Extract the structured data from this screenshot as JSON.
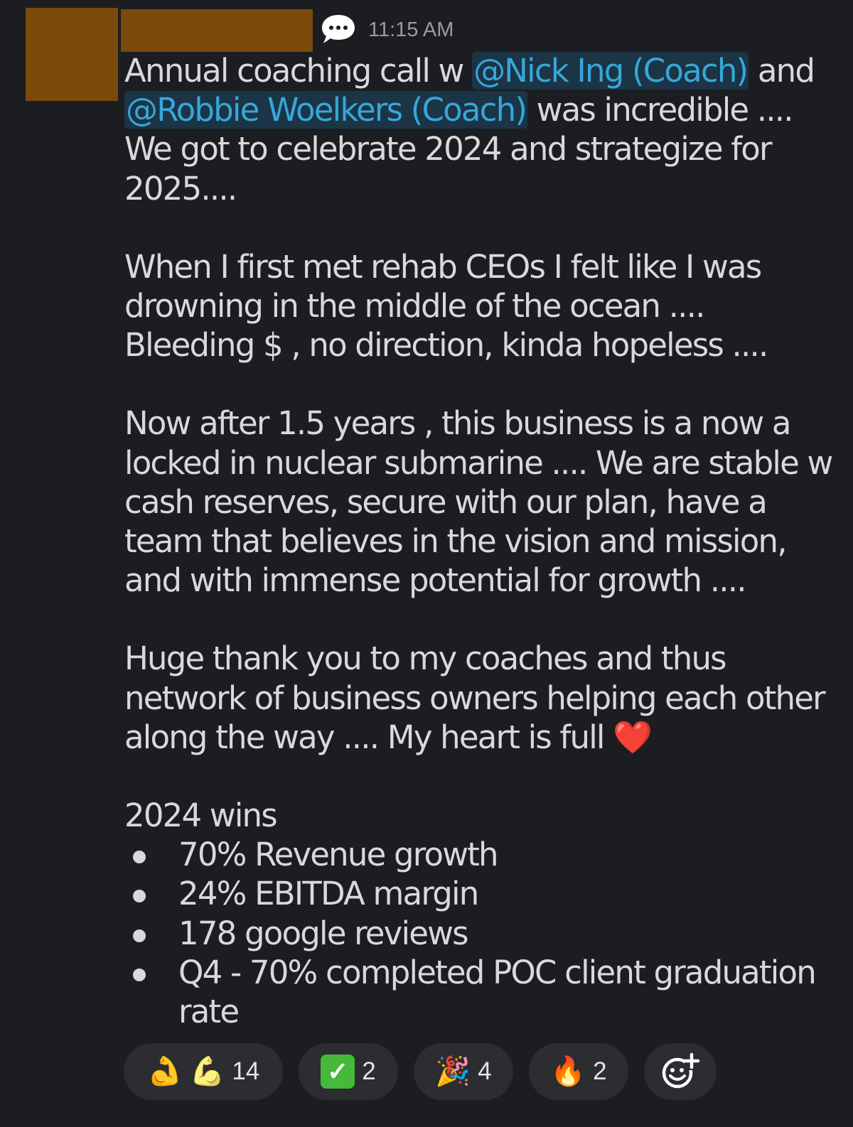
{
  "message": {
    "timestamp": "11:15 AM",
    "line1_text": "Annual coaching call w ",
    "mention1": "@Nick Ing (Coach)",
    "line1_and": " and",
    "mention2": "@Robbie Woelkers (Coach)",
    "line2_rest": " was incredible .... We got to celebrate 2024 and strategize for 2025....",
    "paragraph2": "When I first met rehab CEOs I felt like I was drowning in the middle of the ocean .... Bleeding $ , no direction, kinda hopeless ....",
    "paragraph3": "Now after 1.5 years , this business is a now a locked in nuclear submarine .... We are stable w cash reserves, secure with our plan, have a team that believes in the vision and mission, and with immense potential for growth ....",
    "paragraph4": "Huge thank you to my coaches and thus network of business owners helping each other along the way .... My heart is full ",
    "heart_emoji": "❤️",
    "wins_heading": "2024 wins",
    "wins": [
      "70% Revenue growth",
      "24% EBITDA margin",
      "178 google reviews",
      "Q4 - 70% completed POC client graduation rate"
    ]
  },
  "reactions": [
    {
      "icon": "flexed-biceps",
      "emoji": "💪",
      "emoji2": "💪",
      "count": "14"
    },
    {
      "icon": "check-mark",
      "emoji": "✓",
      "count": "2"
    },
    {
      "icon": "party-popper",
      "emoji": "🎉",
      "count": "4"
    },
    {
      "icon": "fire",
      "emoji": "🔥",
      "count": "2"
    }
  ],
  "add_reaction_icon": "add-reaction-icon",
  "colors": {
    "background": "#1b1d21",
    "text": "#d8d9da",
    "mention": "#36a7d8",
    "pill": "#2b2d31",
    "redaction": "#7a4a0a"
  }
}
